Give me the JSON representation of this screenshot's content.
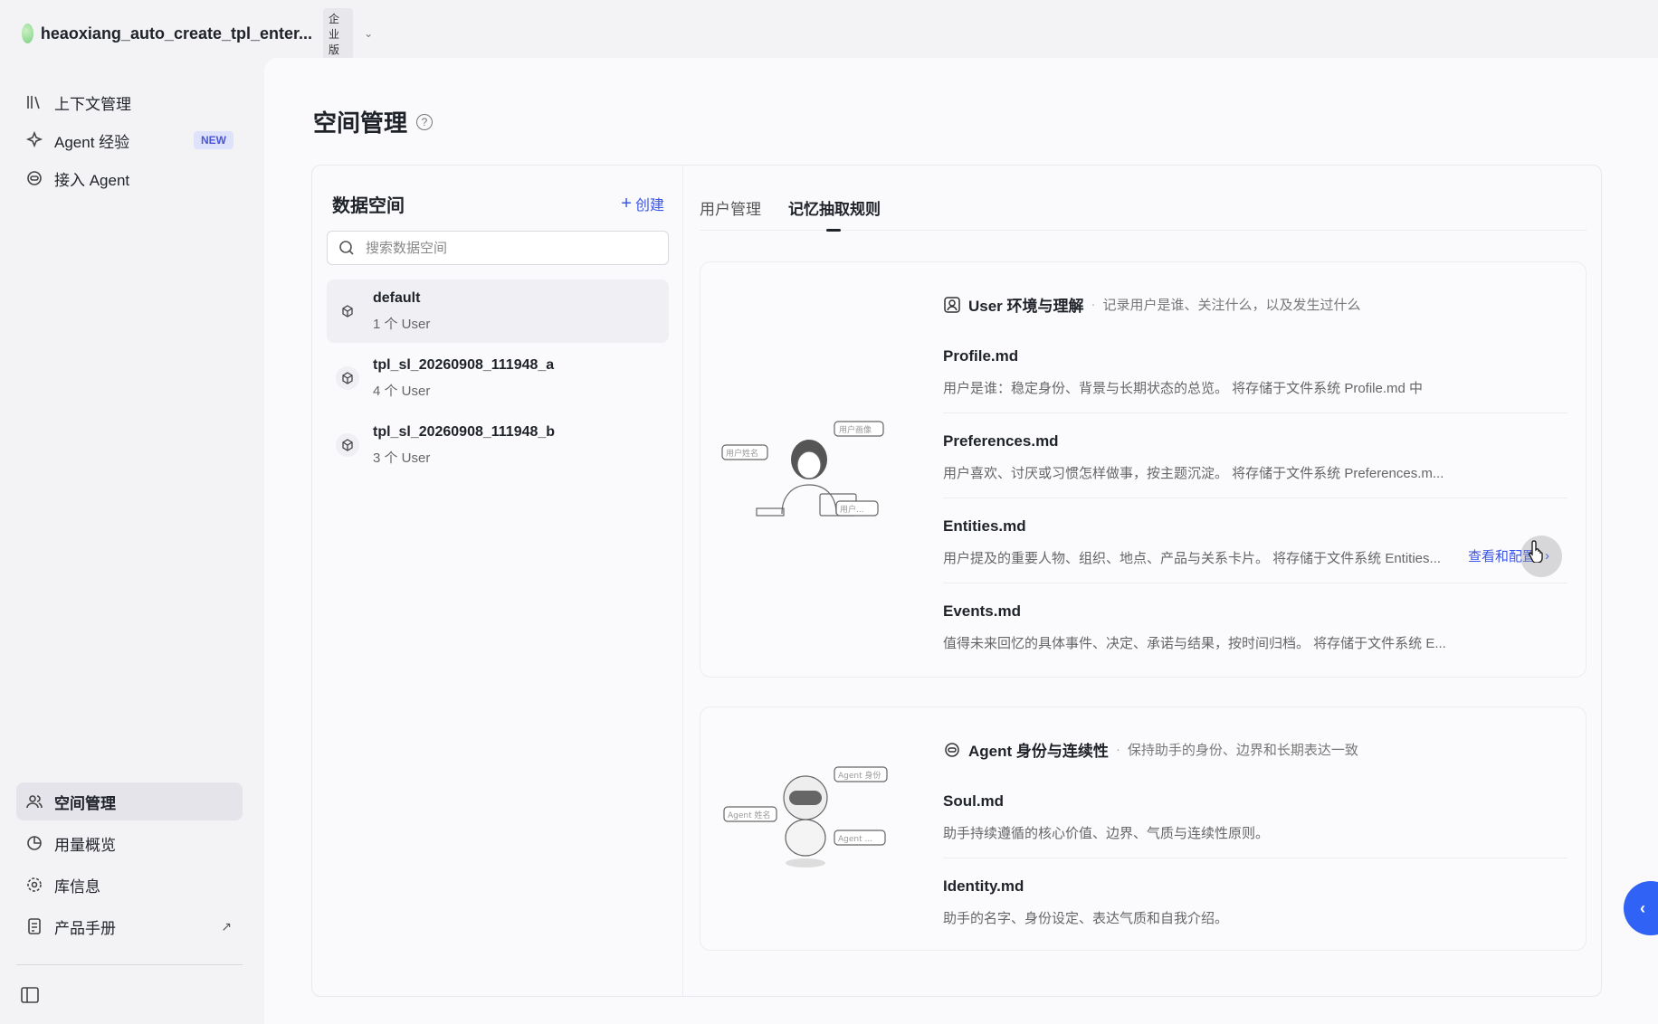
{
  "workspace": {
    "name": "heaoxiang_auto_create_tpl_enter...",
    "badge": "企业版"
  },
  "sidebar": {
    "top_items": [
      {
        "label": "上下文管理",
        "icon": "library-icon"
      },
      {
        "label": "Agent 经验",
        "icon": "sparkle-icon",
        "badge": "NEW"
      },
      {
        "label": "接入 Agent",
        "icon": "agent-icon"
      }
    ],
    "bottom_items": [
      {
        "label": "空间管理",
        "icon": "users-icon",
        "active": true
      },
      {
        "label": "用量概览",
        "icon": "pie-chart-icon"
      },
      {
        "label": "库信息",
        "icon": "gear-icon"
      },
      {
        "label": "产品手册",
        "icon": "manual-icon",
        "external": "↗"
      }
    ]
  },
  "page": {
    "title": "空间管理"
  },
  "data_spaces": {
    "title": "数据空间",
    "create_label": "创建",
    "search_placeholder": "搜索数据空间",
    "items": [
      {
        "name": "default",
        "count": "1 个 User",
        "active": true
      },
      {
        "name": "tpl_sl_20260908_111948_a",
        "count": "4 个 User"
      },
      {
        "name": "tpl_sl_20260908_111948_b",
        "count": "3 个 User"
      }
    ]
  },
  "tabs": [
    {
      "label": "用户管理"
    },
    {
      "label": "记忆抽取规则",
      "active": true
    }
  ],
  "cards": [
    {
      "title": "User 环境与理解",
      "desc": "记录用户是谁、关注什么，以及发生过什么",
      "illustration_labels": [
        "用户画像",
        "用户姓名",
        "用户..."
      ],
      "files": [
        {
          "name": "Profile.md",
          "desc": "用户是谁：稳定身份、背景与长期状态的总览。 将存储于文件系统 Profile.md 中"
        },
        {
          "name": "Preferences.md",
          "desc": "用户喜欢、讨厌或习惯怎样做事，按主题沉淀。 将存储于文件系统 Preferences.m..."
        },
        {
          "name": "Entities.md",
          "desc": "用户提及的重要人物、组织、地点、产品与关系卡片。 将存储于文件系统 Entities...",
          "link": "查看和配置"
        },
        {
          "name": "Events.md",
          "desc": "值得未来回忆的具体事件、决定、承诺与结果，按时间归档。 将存储于文件系统 E..."
        }
      ]
    },
    {
      "title": "Agent 身份与连续性",
      "desc": "保持助手的身份、边界和长期表达一致",
      "illustration_labels": [
        "Agent 身份",
        "Agent 姓名",
        "Agent ..."
      ],
      "files": [
        {
          "name": "Soul.md",
          "desc": "助手持续遵循的核心价值、边界、气质与连续性原则。"
        },
        {
          "name": "Identity.md",
          "desc": "助手的名字、身份设定、表达气质和自我介绍。"
        }
      ]
    }
  ],
  "float_button": {
    "label": "‹"
  }
}
